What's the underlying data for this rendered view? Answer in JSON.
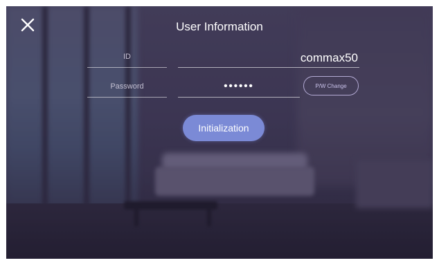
{
  "screen": {
    "title": "User Information"
  },
  "fields": {
    "id": {
      "label": "ID",
      "value": "commax50"
    },
    "password": {
      "label": "Password",
      "value": "••••••"
    }
  },
  "buttons": {
    "close_icon": "close-icon",
    "pw_change_label": "P/W Change",
    "initialization_label": "Initialization"
  },
  "colors": {
    "accent": "#7b8ad6",
    "text": "#ffffff",
    "label": "#c3bfd1"
  }
}
